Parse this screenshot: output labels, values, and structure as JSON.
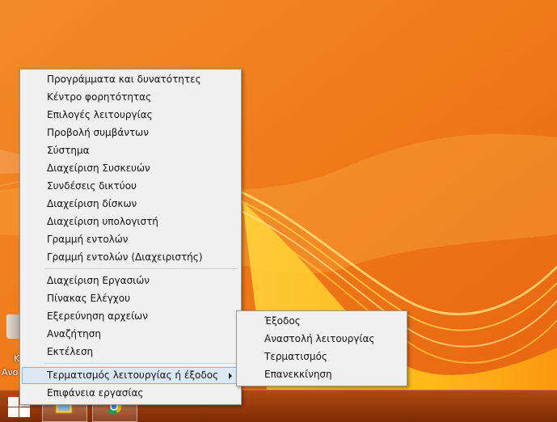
{
  "desktop": {
    "icon_label_line1": "Κ",
    "icon_label_line2": "Ανο"
  },
  "context_menu": {
    "group1": [
      "Προγράμματα και δυνατότητες",
      "Κέντρο φορητότητας",
      "Επιλογές λειτουργίας",
      "Προβολή συμβάντων",
      "Σύστημα",
      "Διαχείριση Συσκευών",
      "Συνδέσεις δικτύου",
      "Διαχείριση δίσκων",
      "Διαχείριση υπολογιστή",
      "Γραμμή εντολών",
      "Γραμμή εντολών (Διαχειριστής)"
    ],
    "group2": [
      "Διαχείριση Εργασιών",
      "Πίνακας Ελέγχου",
      "Εξερεύνηση αρχείων",
      "Αναζήτηση",
      "Εκτέλεση"
    ],
    "shutdown_item": "Τερματισμός λειτουργίας ή έξοδος",
    "desktop_item": "Επιφάνεια εργασίας"
  },
  "submenu": {
    "items": [
      "Έξοδος",
      "Αναστολή λειτουργίας",
      "Τερματισμός",
      "Επανεκκίνηση"
    ]
  },
  "colors": {
    "background": "#f07a1c",
    "menu_bg": "#f0f0f0",
    "highlight_bg": "#dbe8f8",
    "highlight_border": "#8fb3e0",
    "taskbar": "#8f350a"
  },
  "icons": {
    "start": "windows-logo-icon",
    "taskbar_1": "file-explorer-icon",
    "taskbar_2": "chrome-icon"
  }
}
